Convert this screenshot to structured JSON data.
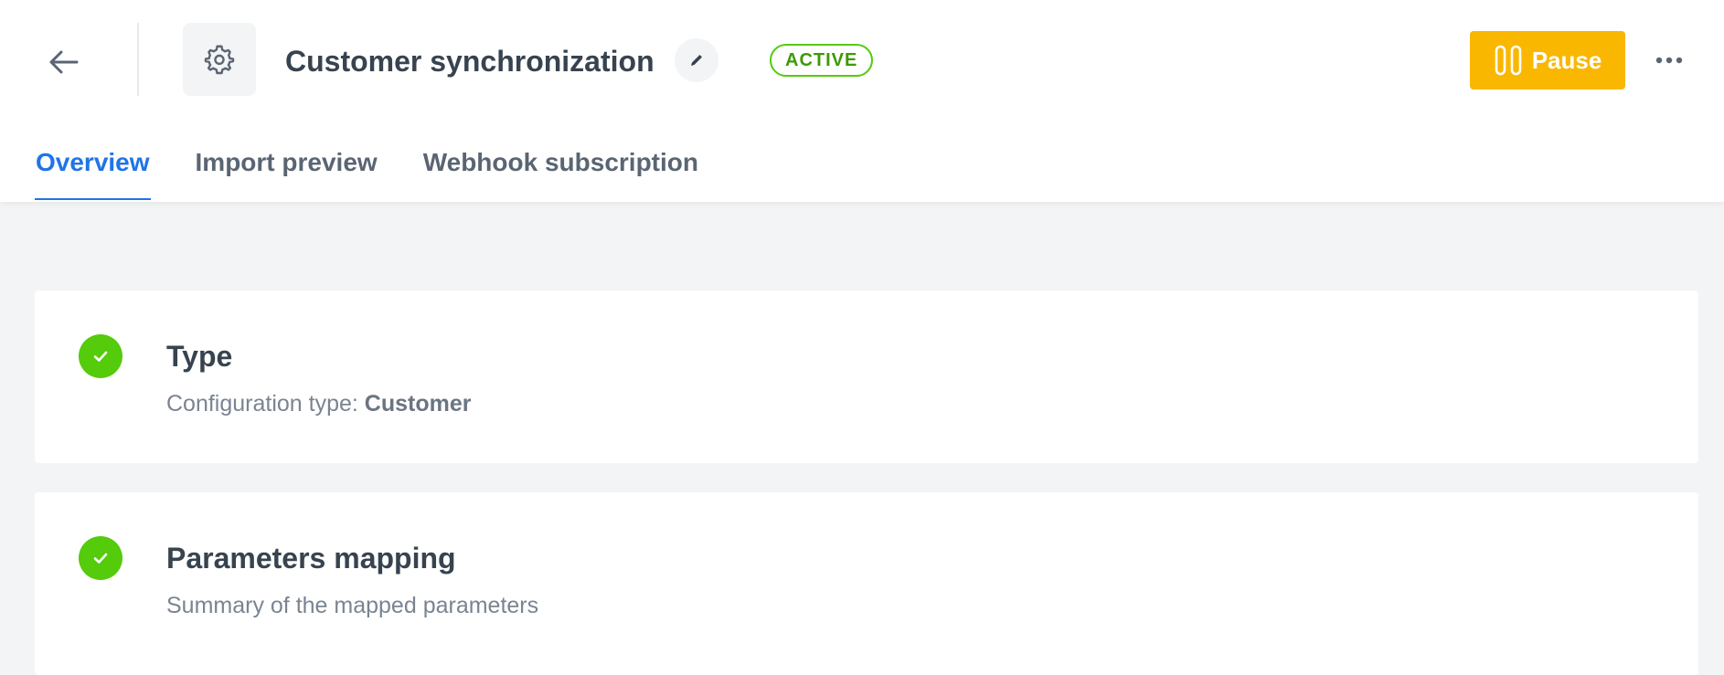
{
  "header": {
    "title": "Customer synchronization",
    "status": "ACTIVE",
    "pause_label": "Pause",
    "icons": {
      "back": "arrow-left-icon",
      "settings": "gear-icon",
      "edit": "pencil-icon",
      "pause": "pause-icon",
      "more": "more-horizontal-icon"
    }
  },
  "tabs": [
    {
      "label": "Overview",
      "active": true
    },
    {
      "label": "Import preview",
      "active": false
    },
    {
      "label": "Webhook subscription",
      "active": false
    }
  ],
  "cards": {
    "type": {
      "title": "Type",
      "desc_prefix": "Configuration type: ",
      "desc_value": "Customer"
    },
    "params": {
      "title": "Parameters mapping",
      "desc": "Summary of the mapped parameters"
    }
  },
  "colors": {
    "accent": "#1f74e8",
    "success": "#54cb0b",
    "pause": "#fab700",
    "text": "#384350"
  }
}
